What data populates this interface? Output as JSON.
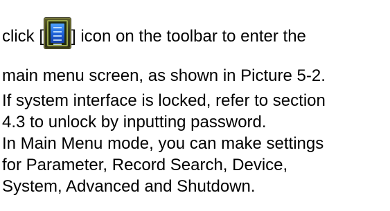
{
  "paragraph1": {
    "before_icon": "click [",
    "after_icon": "] icon on the toolbar to enter the",
    "line2": "main menu screen, as shown in Picture 5-2.",
    "line3": "If system interface is locked, refer to section",
    "line4": "4.3 to unlock by inputting password."
  },
  "paragraph2": {
    "line1": "In Main Menu mode, you can make settings",
    "line2": "for Parameter, Record Search, Device,",
    "line3": "System, Advanced and Shutdown."
  },
  "icon": {
    "name": "main-menu-icon",
    "frame_color": "#5d5f2a",
    "screen_color": "#1d5fd6"
  }
}
